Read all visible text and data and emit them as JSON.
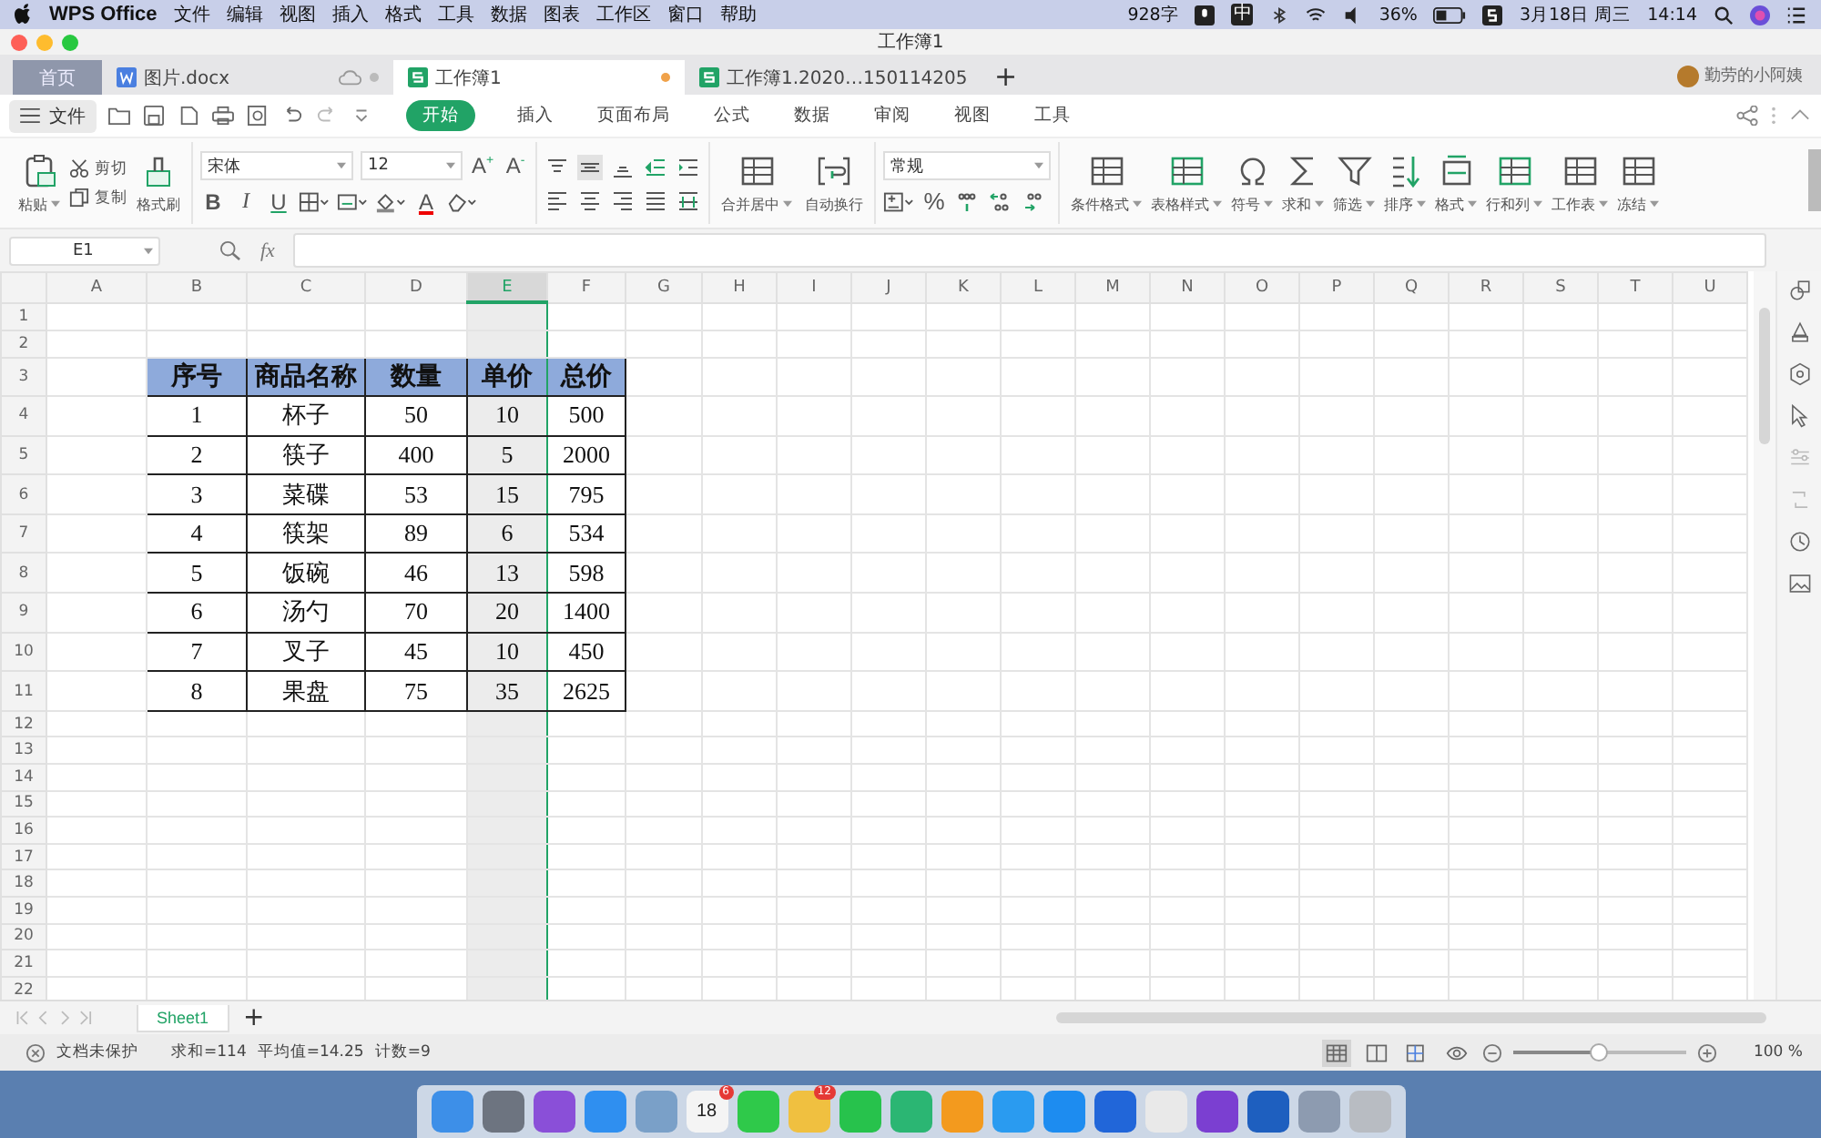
{
  "menubar": {
    "app": "WPS Office",
    "items": [
      "文件",
      "编辑",
      "视图",
      "插入",
      "格式",
      "工具",
      "数据",
      "图表",
      "工作区",
      "窗口",
      "帮助"
    ],
    "word_count": "928字",
    "ime": "中",
    "battery": "36%",
    "date": "3月18日 周三",
    "time": "14:14"
  },
  "window": {
    "title": "工作簿1"
  },
  "doc_tabs": [
    {
      "label": "首页",
      "kind": "home",
      "selected": false
    },
    {
      "label": "图片.docx",
      "kind": "doc",
      "selected": false
    },
    {
      "label": "工作簿1",
      "kind": "sheet",
      "selected": true
    },
    {
      "label": "工作簿1.2020…150114205",
      "kind": "sheet",
      "selected": false
    }
  ],
  "new_tab": "+",
  "user": "勤劳的小阿姨",
  "file_menu": "文件",
  "ribbon_tabs": [
    {
      "label": "开始",
      "selected": true
    },
    {
      "label": "插入",
      "selected": false
    },
    {
      "label": "页面布局",
      "selected": false
    },
    {
      "label": "公式",
      "selected": false
    },
    {
      "label": "数据",
      "selected": false
    },
    {
      "label": "审阅",
      "selected": false
    },
    {
      "label": "视图",
      "selected": false
    },
    {
      "label": "工具",
      "selected": false
    }
  ],
  "toolbar": {
    "paste": "粘贴",
    "cut": "剪切",
    "copy": "复制",
    "format_painter": "格式刷",
    "font": "宋体",
    "font_size": "12",
    "grow": "A$^{+}$",
    "shrink": "A$^{-}$",
    "styles": [
      "B",
      "I",
      "U"
    ],
    "font_color": "A",
    "merge": "合并居中",
    "wrap": "自动换行",
    "number_format": "常规",
    "percent": "%",
    "big_buttons": [
      {
        "label": "条件格式"
      },
      {
        "label": "表格样式"
      },
      {
        "label": "符号"
      },
      {
        "label": "求和"
      },
      {
        "label": "筛选"
      },
      {
        "label": "排序"
      },
      {
        "label": "格式"
      },
      {
        "label": "行和列"
      },
      {
        "label": "工作表"
      },
      {
        "label": "冻结"
      }
    ]
  },
  "formula_bar": {
    "cell": "E1",
    "fx": "fx"
  },
  "sheet": {
    "columns": [
      {
        "label": "A",
        "selected": false
      },
      {
        "label": "B",
        "selected": false
      },
      {
        "label": "C",
        "selected": false
      },
      {
        "label": "D",
        "selected": false
      },
      {
        "label": "E",
        "selected": true
      },
      {
        "label": "F",
        "selected": false
      },
      {
        "label": "G",
        "selected": false
      },
      {
        "label": "H",
        "selected": false
      },
      {
        "label": "I",
        "selected": false
      },
      {
        "label": "J",
        "selected": false
      },
      {
        "label": "K",
        "selected": false
      },
      {
        "label": "L",
        "selected": false
      },
      {
        "label": "M",
        "selected": false
      },
      {
        "label": "N",
        "selected": false
      },
      {
        "label": "O",
        "selected": false
      },
      {
        "label": "P",
        "selected": false
      },
      {
        "label": "Q",
        "selected": false
      },
      {
        "label": "R",
        "selected": false
      },
      {
        "label": "S",
        "selected": false
      },
      {
        "label": "T",
        "selected": false
      },
      {
        "label": "U",
        "selected": false
      }
    ],
    "rows": [
      "1",
      "2",
      "3",
      "4",
      "5",
      "6",
      "7",
      "8",
      "9",
      "10",
      "11",
      "12",
      "13",
      "14",
      "15",
      "16",
      "17",
      "18",
      "19",
      "20",
      "21",
      "22"
    ],
    "table": {
      "header": [
        "序号",
        "商品名称",
        "数量",
        "单价",
        "总价"
      ],
      "body": [
        [
          "1",
          "杯子",
          "50",
          "10",
          "500"
        ],
        [
          "2",
          "筷子",
          "400",
          "5",
          "2000"
        ],
        [
          "3",
          "菜碟",
          "53",
          "15",
          "795"
        ],
        [
          "4",
          "筷架",
          "89",
          "6",
          "534"
        ],
        [
          "5",
          "饭碗",
          "46",
          "13",
          "598"
        ],
        [
          "6",
          "汤勺",
          "70",
          "20",
          "1400"
        ],
        [
          "7",
          "叉子",
          "45",
          "10",
          "450"
        ],
        [
          "8",
          "果盘",
          "75",
          "35",
          "2625"
        ]
      ]
    }
  },
  "sheet_tabs": [
    {
      "label": "Sheet1",
      "selected": true
    }
  ],
  "add_sheet": "+",
  "status_bar": {
    "protection": "文档未保护",
    "sum": "求和=114",
    "average": "平均值=14.25",
    "count": "计数=9",
    "zoom": "100 %",
    "zoom_slider": {
      "level": 0.5
    }
  },
  "dock": [
    {
      "color": "#3d8fe8"
    },
    {
      "color": "#6d7480"
    },
    {
      "color": "#8a4fd8"
    },
    {
      "color": "#2f8ff0"
    },
    {
      "color": "#7aa0c8"
    },
    {
      "color": "#f4f4f4",
      "text": "18",
      "badge": "6"
    },
    {
      "color": "#2fc94a"
    },
    {
      "color": "#f0c040",
      "badge": "12"
    },
    {
      "color": "#27c24c"
    },
    {
      "color": "#2bb673"
    },
    {
      "color": "#f39a1e"
    },
    {
      "color": "#2a9bf0"
    },
    {
      "color": "#1d8cf0"
    },
    {
      "color": "#2166d9"
    },
    {
      "color": "#e9e9e9"
    },
    {
      "color": "#7b3fd1"
    },
    {
      "color": "#1e5fbf"
    },
    {
      "color": "#8d9bb0"
    },
    {
      "color": "#b8bcc2"
    }
  ]
}
